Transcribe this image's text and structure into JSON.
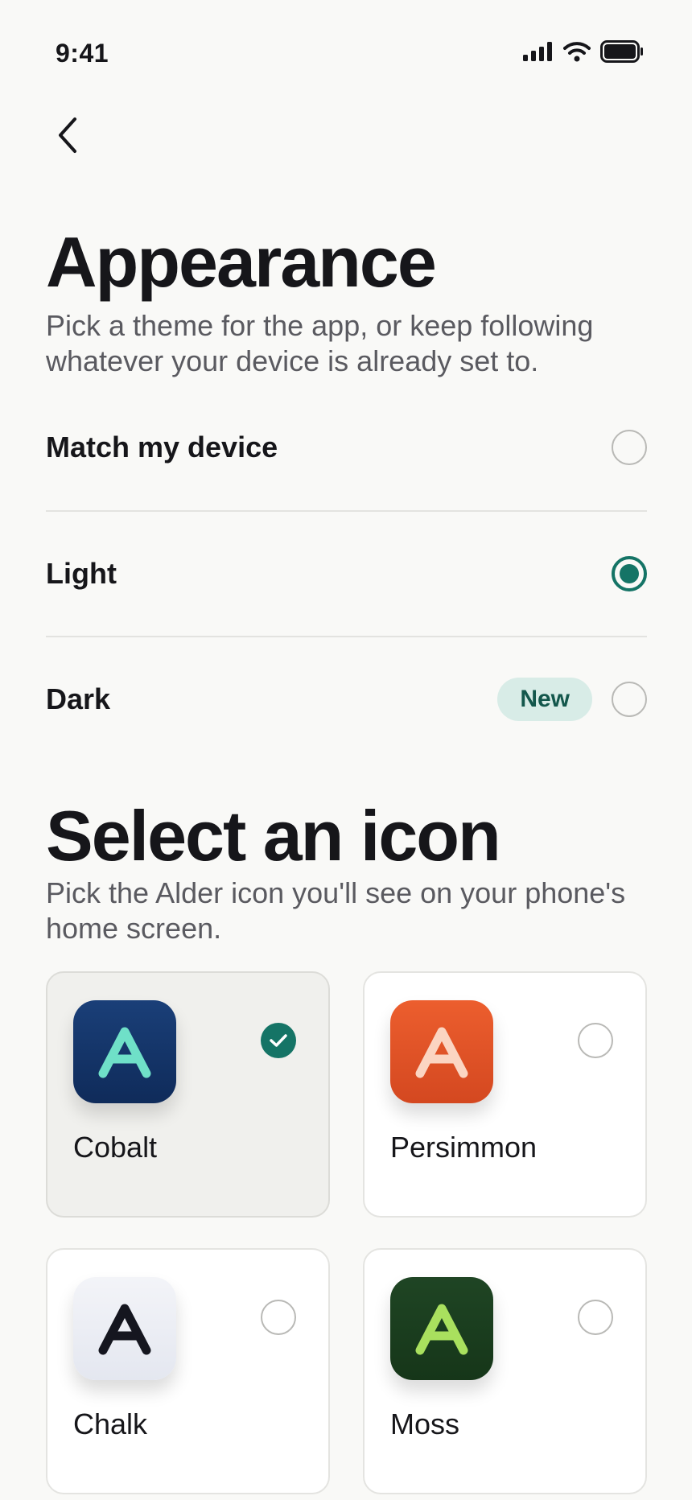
{
  "status_bar": {
    "time": "9:41",
    "icons": [
      "signal-icon",
      "wifi-icon",
      "battery-icon"
    ]
  },
  "nav": {
    "back_icon": "chevron-left-icon"
  },
  "appearance": {
    "title": "Appearance",
    "description": "Pick a theme for the app, or keep following whatever your device is already set to.",
    "options": [
      {
        "label": "Match my device",
        "selected": false
      },
      {
        "label": "Light",
        "selected": true
      },
      {
        "label": "Dark",
        "selected": false,
        "badge": "New"
      }
    ]
  },
  "icon_picker": {
    "title": "Select an icon",
    "description": "Pick the Alder icon you'll see on your phone's home screen.",
    "icons": [
      {
        "name": "Cobalt",
        "glyph": "A",
        "selected": true,
        "bg_top": "#1a3f78",
        "bg_bottom": "#0f2b5a",
        "glyph_color": "#6fe0c8"
      },
      {
        "name": "Persimmon",
        "glyph": "A",
        "selected": false,
        "bg_top": "#ec5e2e",
        "bg_bottom": "#d44820",
        "glyph_color": "#fbd5c2"
      },
      {
        "name": "Chalk",
        "glyph": "A",
        "selected": false,
        "bg_top": "#f3f4f8",
        "bg_bottom": "#e4e7f0",
        "glyph_color": "#15161f"
      },
      {
        "name": "Moss",
        "glyph": "A",
        "selected": false,
        "bg_top": "#1f4524",
        "bg_bottom": "#163619",
        "glyph_color": "#a9e05e"
      }
    ]
  },
  "colors": {
    "accent": "#157466",
    "badge_bg": "#d8ece7",
    "badge_text": "#13574c"
  }
}
